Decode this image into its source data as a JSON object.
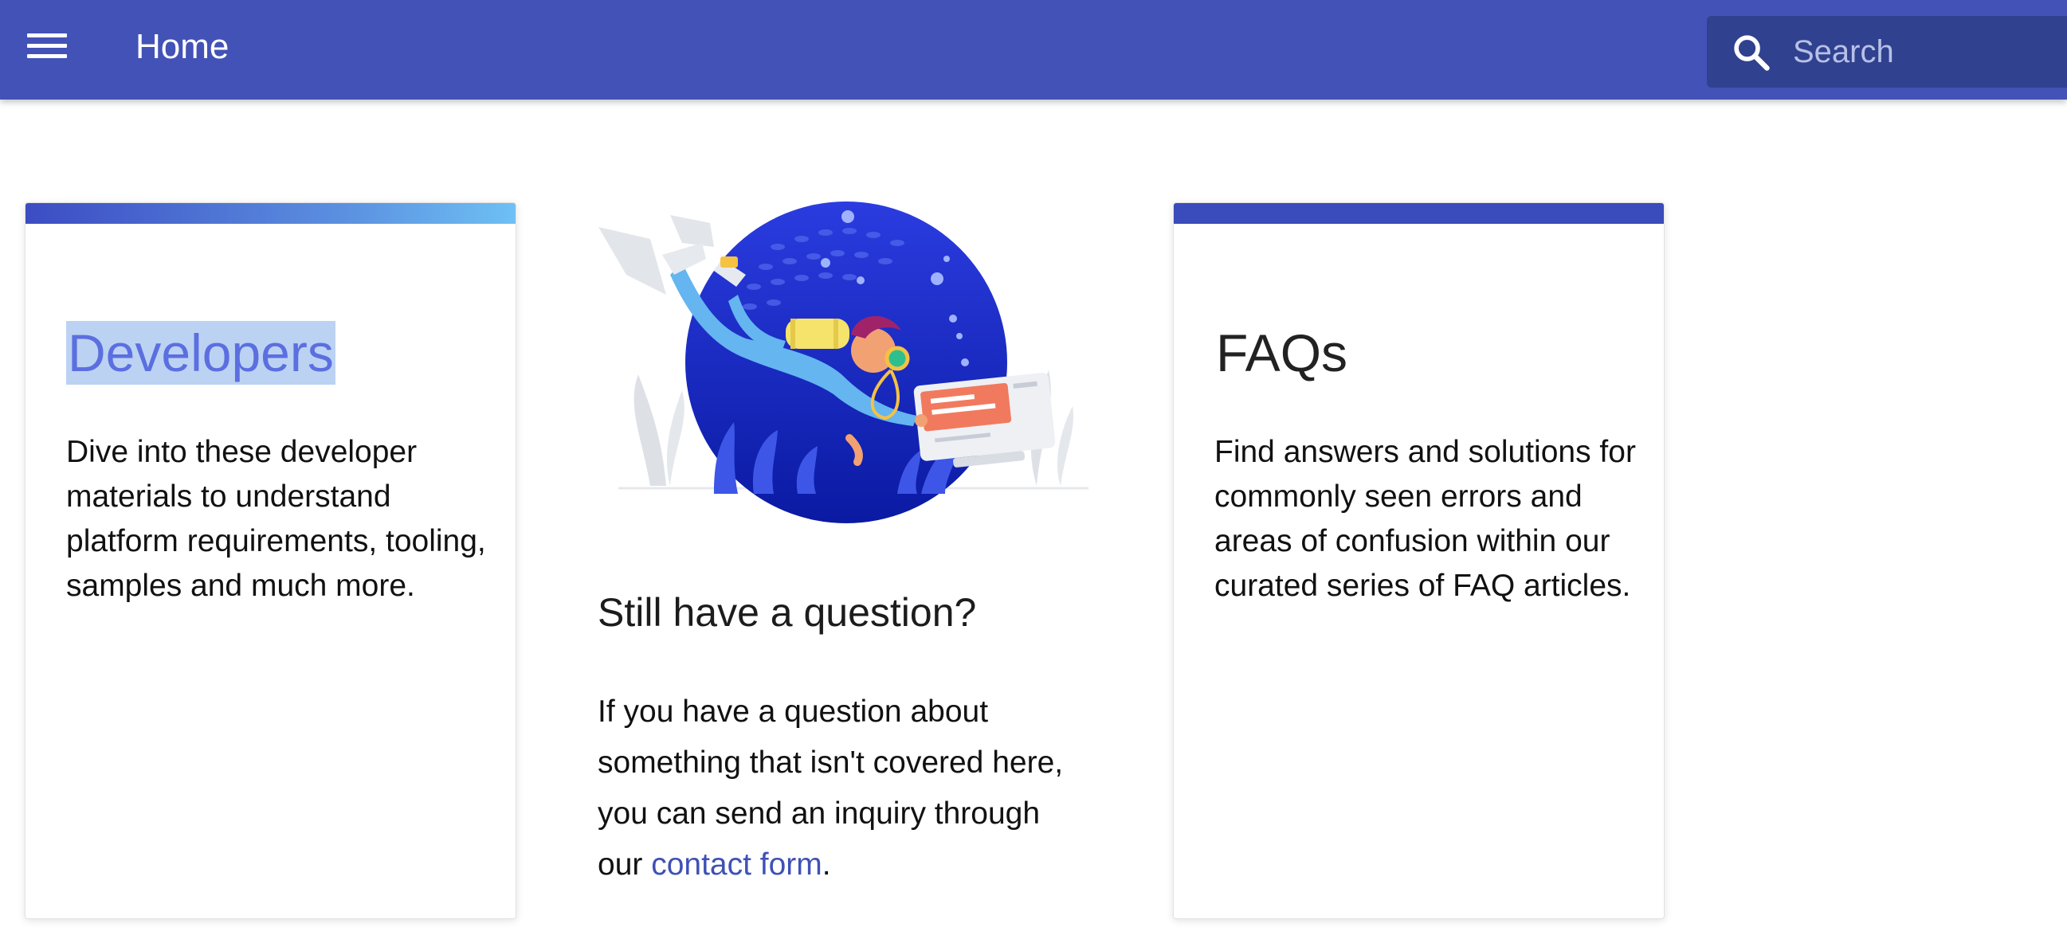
{
  "header": {
    "menu_icon": "hamburger-menu-icon",
    "title": "Home",
    "search": {
      "icon": "search-icon",
      "placeholder": "Search",
      "value": ""
    },
    "color": "#4352b6"
  },
  "cards": [
    {
      "title": "Developers",
      "text": "Dive into these developer materials to understand platform requirements, tooling, samples and much more.",
      "selected": true
    },
    {
      "title": "FAQs",
      "text": "Find answers and solutions for commonly seen errors and areas of confusion within our curated series of FAQ articles."
    }
  ],
  "question": {
    "title": "Still have a question?",
    "text_before": "If you have a question about something that isn't covered here, you can send an inquiry through our ",
    "link_label": "contact form",
    "text_after": "."
  },
  "illustration": {
    "icon": "scuba-diver-illustration"
  },
  "colors": {
    "accent": "#3f51b5",
    "header": "#4352b6",
    "search_bg": "#30418f",
    "selection": "#bcd2f3"
  }
}
